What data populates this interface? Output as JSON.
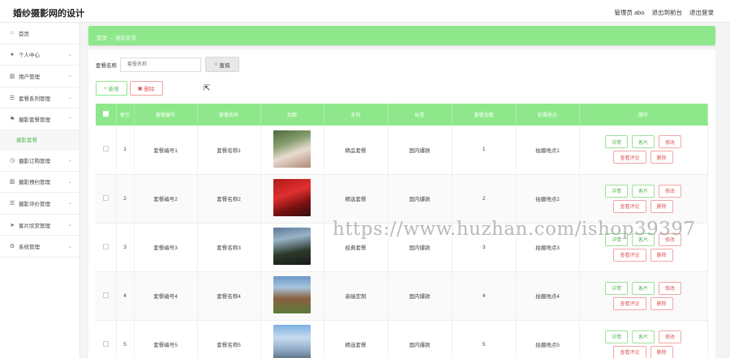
{
  "app": {
    "title": "婚纱摄影网的设计"
  },
  "header": {
    "admin_label": "管理员 abo",
    "back_label": "退出到前台",
    "logout_label": "退出登录"
  },
  "sidebar": {
    "items": [
      {
        "label": "首页",
        "icon": "home-icon",
        "glyph": "⌂"
      },
      {
        "label": "个人中心",
        "icon": "user-icon",
        "glyph": "●"
      },
      {
        "label": "用户管理",
        "icon": "chart-icon",
        "glyph": "▥"
      },
      {
        "label": "套餐系列管理",
        "icon": "list-icon",
        "glyph": "☰"
      },
      {
        "label": "摄影套餐管理",
        "icon": "flag-icon",
        "glyph": "⚑"
      },
      {
        "label": "摄影订购管理",
        "icon": "clock-icon",
        "glyph": "◷"
      },
      {
        "label": "摄影预约管理",
        "icon": "chart-icon",
        "glyph": "▥"
      },
      {
        "label": "摄影评价管理",
        "icon": "list-icon",
        "glyph": "☰"
      },
      {
        "label": "客片欣赏管理",
        "icon": "send-icon",
        "glyph": "➤"
      },
      {
        "label": "系统管理",
        "icon": "gear-icon",
        "glyph": "⚙"
      }
    ],
    "sub_active": "摄影套餐"
  },
  "breadcrumb": {
    "home": "首页",
    "sep": "→",
    "current": "摄影套餐"
  },
  "search": {
    "label": "套餐名称",
    "placeholder": "套餐名称",
    "button": "查询"
  },
  "toolbar": {
    "add": "新增",
    "delete": "删除"
  },
  "table": {
    "headers": [
      "索引",
      "套餐编号",
      "套餐名称",
      "封面",
      "系列",
      "标签",
      "套餐金额",
      "拍摄地点",
      "操作"
    ],
    "rows": [
      {
        "index": "1",
        "code": "套餐编号1",
        "name": "套餐名称1",
        "series": "精品套餐",
        "tag": "国内爆款",
        "amount": "1",
        "location": "拍摄地点1"
      },
      {
        "index": "2",
        "code": "套餐编号2",
        "name": "套餐名称2",
        "series": "精选套餐",
        "tag": "国内爆款",
        "amount": "2",
        "location": "拍摄地点2"
      },
      {
        "index": "3",
        "code": "套餐编号3",
        "name": "套餐名称3",
        "series": "经典套餐",
        "tag": "国内爆款",
        "amount": "3",
        "location": "拍摄地点3"
      },
      {
        "index": "4",
        "code": "套餐编号4",
        "name": "套餐名称4",
        "series": "高端定制",
        "tag": "国内爆款",
        "amount": "4",
        "location": "拍摄地点4"
      },
      {
        "index": "5",
        "code": "套餐编号5",
        "name": "套餐名称5",
        "series": "精选套餐",
        "tag": "国内爆款",
        "amount": "5",
        "location": "拍摄地点5"
      }
    ],
    "ops": {
      "detail": "详情",
      "photos": "客片",
      "edit": "修改",
      "reviews": "查看评论",
      "delete": "删除"
    }
  },
  "watermark": "https://www.huzhan.com/ishop39397",
  "colors": {
    "accent": "#8ee88b",
    "danger": "#e05555",
    "success": "#5cb85c"
  }
}
